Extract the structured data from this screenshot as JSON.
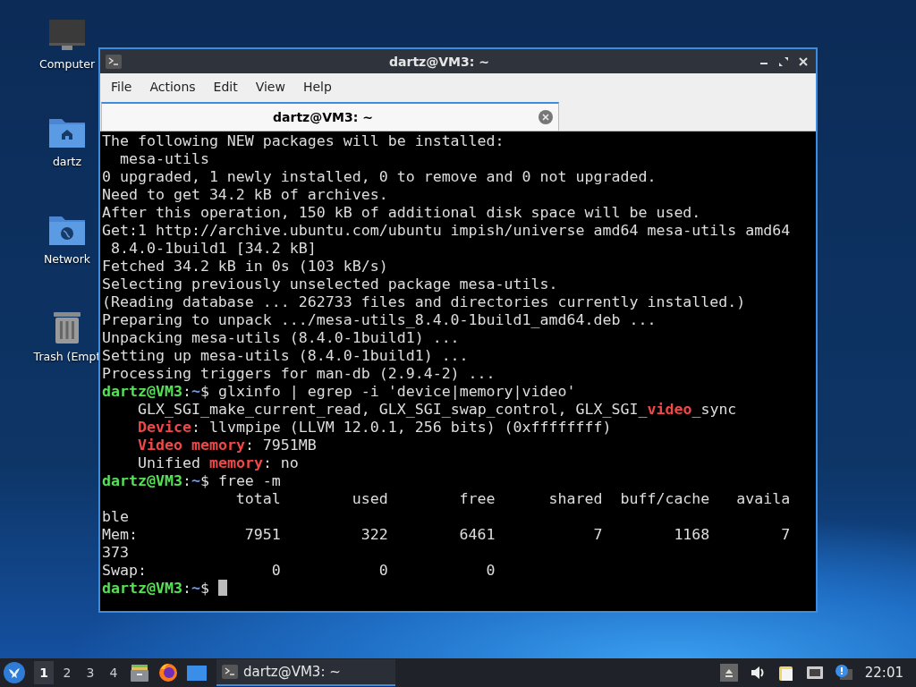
{
  "desktop_icons": [
    {
      "kind": "computer",
      "label": "Computer"
    },
    {
      "kind": "home-folder",
      "label": "dartz"
    },
    {
      "kind": "network-folder",
      "label": "Network"
    },
    {
      "kind": "trash",
      "label": "Trash (Empt"
    }
  ],
  "window": {
    "title": "dartz@VM3: ~",
    "menu": [
      "File",
      "Actions",
      "Edit",
      "View",
      "Help"
    ],
    "tabs": [
      {
        "label": "dartz@VM3: ~",
        "selected": true
      }
    ],
    "terminal": {
      "lines": [
        [
          {
            "kind": "plain",
            "text": "The following NEW packages will be installed:"
          }
        ],
        [
          {
            "kind": "plain",
            "text": "  mesa-utils"
          }
        ],
        [
          {
            "kind": "plain",
            "text": "0 upgraded, 1 newly installed, 0 to remove and 0 not upgraded."
          }
        ],
        [
          {
            "kind": "plain",
            "text": "Need to get 34.2 kB of archives."
          }
        ],
        [
          {
            "kind": "plain",
            "text": "After this operation, 150 kB of additional disk space will be used."
          }
        ],
        [
          {
            "kind": "plain",
            "text": "Get:1 http://archive.ubuntu.com/ubuntu impish/universe amd64 mesa-utils amd64"
          }
        ],
        [
          {
            "kind": "plain",
            "text": " 8.4.0-1build1 [34.2 kB]"
          }
        ],
        [
          {
            "kind": "plain",
            "text": "Fetched 34.2 kB in 0s (103 kB/s)"
          }
        ],
        [
          {
            "kind": "plain",
            "text": "Selecting previously unselected package mesa-utils."
          }
        ],
        [
          {
            "kind": "plain",
            "text": "(Reading database ... 262733 files and directories currently installed.)"
          }
        ],
        [
          {
            "kind": "plain",
            "text": "Preparing to unpack .../mesa-utils_8.4.0-1build1_amd64.deb ..."
          }
        ],
        [
          {
            "kind": "plain",
            "text": "Unpacking mesa-utils (8.4.0-1build1) ..."
          }
        ],
        [
          {
            "kind": "plain",
            "text": "Setting up mesa-utils (8.4.0-1build1) ..."
          }
        ],
        [
          {
            "kind": "plain",
            "text": "Processing triggers for man-db (2.9.4-2) ..."
          }
        ],
        [
          {
            "kind": "user",
            "text": "dartz@VM3"
          },
          {
            "kind": "plain",
            "text": ":"
          },
          {
            "kind": "path",
            "text": "~"
          },
          {
            "kind": "plain",
            "text": "$ glxinfo | egrep -i 'device|memory|video'"
          }
        ],
        [
          {
            "kind": "indent"
          },
          {
            "kind": "plain",
            "text": "GLX_SGI_make_current_read, GLX_SGI_swap_control, GLX_SGI_"
          },
          {
            "kind": "match",
            "text": "video"
          },
          {
            "kind": "plain",
            "text": "_sync"
          }
        ],
        [
          {
            "kind": "indent"
          },
          {
            "kind": "match",
            "text": "Device"
          },
          {
            "kind": "plain",
            "text": ": llvmpipe (LLVM 12.0.1, 256 bits) (0xffffffff)"
          }
        ],
        [
          {
            "kind": "indent"
          },
          {
            "kind": "match",
            "text": "Video memory"
          },
          {
            "kind": "plain",
            "text": ": 7951MB"
          }
        ],
        [
          {
            "kind": "indent"
          },
          {
            "kind": "plain",
            "text": "Unified "
          },
          {
            "kind": "match",
            "text": "memory"
          },
          {
            "kind": "plain",
            "text": ": no"
          }
        ],
        [
          {
            "kind": "user",
            "text": "dartz@VM3"
          },
          {
            "kind": "plain",
            "text": ":"
          },
          {
            "kind": "path",
            "text": "~"
          },
          {
            "kind": "plain",
            "text": "$ free -m"
          }
        ],
        [
          {
            "kind": "plain",
            "text": "               total        used        free      shared  buff/cache   availa"
          }
        ],
        [
          {
            "kind": "plain",
            "text": "ble"
          }
        ],
        [
          {
            "kind": "plain",
            "text": "Mem:            7951         322        6461           7        1168        7"
          }
        ],
        [
          {
            "kind": "plain",
            "text": "373"
          }
        ],
        [
          {
            "kind": "plain",
            "text": "Swap:              0           0           0"
          }
        ],
        [
          {
            "kind": "user",
            "text": "dartz@VM3"
          },
          {
            "kind": "plain",
            "text": ":"
          },
          {
            "kind": "path",
            "text": "~"
          },
          {
            "kind": "plain",
            "text": "$ "
          }
        ]
      ]
    }
  },
  "taskbar": {
    "workspaces": [
      {
        "label": "1",
        "selected": true
      },
      {
        "label": "2",
        "selected": false
      },
      {
        "label": "3",
        "selected": false
      },
      {
        "label": "4",
        "selected": false
      }
    ],
    "task": {
      "label": "dartz@VM3: ~"
    },
    "clock": "22:01"
  }
}
